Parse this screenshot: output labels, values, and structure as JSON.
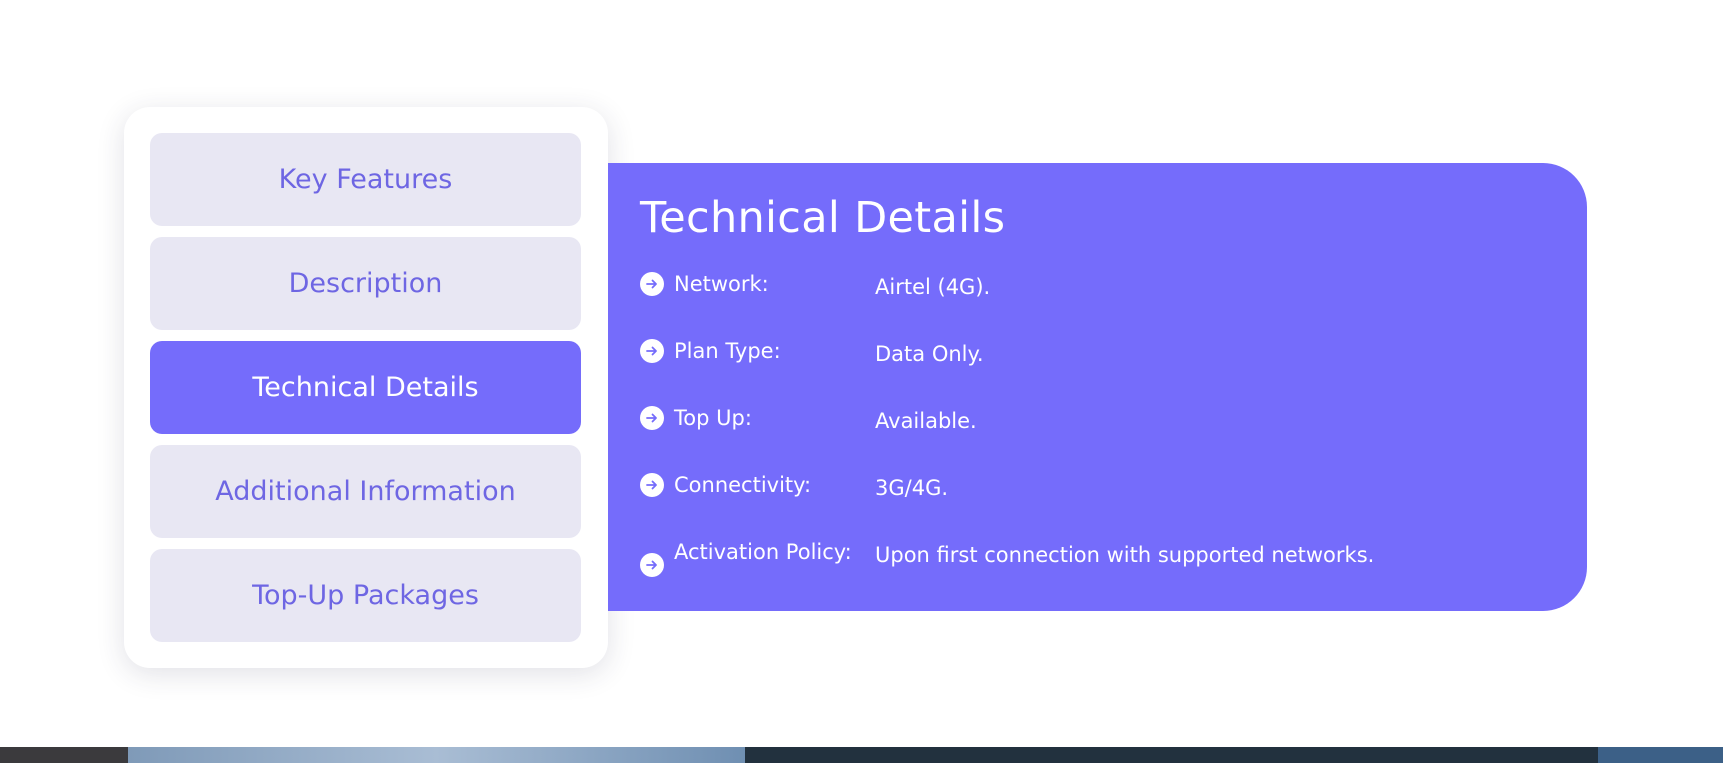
{
  "tabs": [
    {
      "label": "Key Features",
      "active": false
    },
    {
      "label": "Description",
      "active": false
    },
    {
      "label": "Technical Details",
      "active": true
    },
    {
      "label": "Additional Information",
      "active": false
    },
    {
      "label": "Top-Up Packages",
      "active": false
    }
  ],
  "details": {
    "title": "Technical Details",
    "rows": [
      {
        "label": "Network:",
        "value": "Airtel (4G)."
      },
      {
        "label": "Plan Type:",
        "value": "Data Only."
      },
      {
        "label": "Top Up:",
        "value": "Available."
      },
      {
        "label": "Connectivity:",
        "value": "3G/4G."
      },
      {
        "label": "Activation Policy:",
        "value": "Upon first connection with supported networks."
      }
    ]
  },
  "colors": {
    "accent": "#756cfb",
    "tab_bg": "#e8e7f3",
    "tab_text": "#6e66e3"
  },
  "icons": {
    "row_icon": "arrow-right-circle-icon"
  }
}
